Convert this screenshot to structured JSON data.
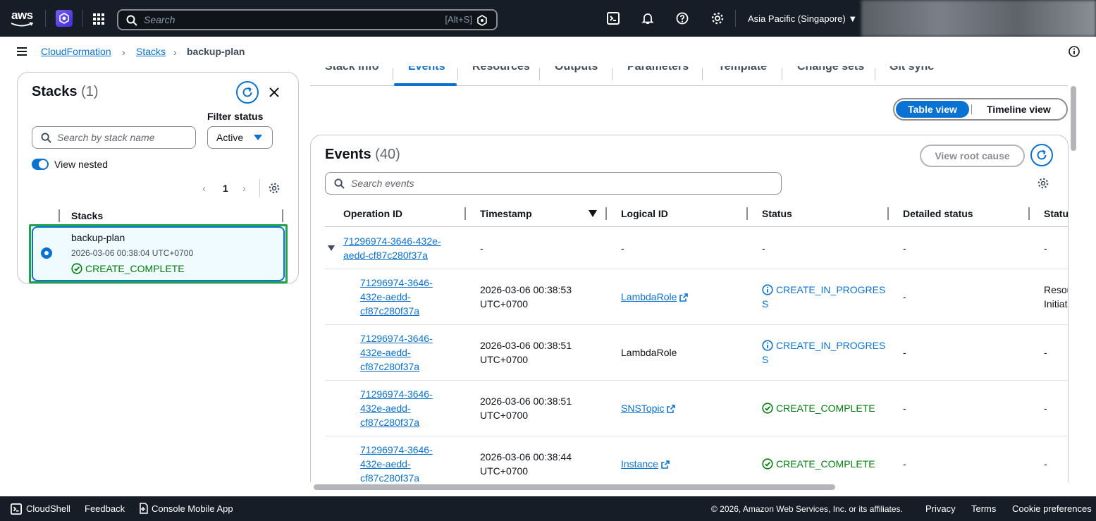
{
  "topnav": {
    "logo_text": "aws",
    "search_placeholder": "Search",
    "search_hint": "[Alt+S]",
    "region": "Asia Pacific (Singapore) ▼"
  },
  "breadcrumb": {
    "items": [
      "CloudFormation",
      "Stacks",
      "backup-plan"
    ]
  },
  "stacks_panel": {
    "title": "Stacks",
    "count": "(1)",
    "filter_label": "Filter status",
    "search_placeholder": "Search by stack name",
    "filter_value": "Active",
    "toggle_label": "View nested",
    "page": "1",
    "column_header": "Stacks",
    "stack": {
      "name": "backup-plan",
      "created": "2026-03-06 00:38:04 UTC+0700",
      "status": "CREATE_COMPLETE"
    }
  },
  "tabs": [
    "Stack info",
    "Events",
    "Resources",
    "Outputs",
    "Parameters",
    "Template",
    "Change sets",
    "Git sync"
  ],
  "view_toggle": {
    "table": "Table view",
    "timeline": "Timeline view"
  },
  "events": {
    "title": "Events",
    "count": "(40)",
    "root_cause_label": "View root cause",
    "search_placeholder": "Search events",
    "columns": [
      "Operation ID",
      "Timestamp",
      "Logical ID",
      "Status",
      "Detailed status",
      "Status reason"
    ],
    "group_row": {
      "operation_id_1": "71296974-3646-432e-",
      "operation_id_2": "aedd-cf87c280f37a",
      "timestamp": "-",
      "logical_id": "-",
      "status": "-",
      "detailed": "-",
      "reason": "-"
    },
    "rows": [
      {
        "op1": "71296974-3646-",
        "op2": "432e-aedd-",
        "op3": "cf87c280f37a",
        "ts1": "2026-03-06 00:38:53",
        "ts2": "UTC+0700",
        "logical": "LambdaRole",
        "status1": "CREATE_IN_PROGRES",
        "status2": "S",
        "detailed": "-",
        "reason1": "Resource creation",
        "reason2": "Initiated"
      },
      {
        "op1": "71296974-3646-",
        "op2": "432e-aedd-",
        "op3": "cf87c280f37a",
        "ts1": "2026-03-06 00:38:51",
        "ts2": "UTC+0700",
        "logical": "LambdaRole",
        "status1": "CREATE_IN_PROGRES",
        "status2": "S",
        "detailed": "-",
        "reason1": "-",
        "reason2": ""
      },
      {
        "op1": "71296974-3646-",
        "op2": "432e-aedd-",
        "op3": "cf87c280f37a",
        "ts1": "2026-03-06 00:38:51",
        "ts2": "UTC+0700",
        "logical": "SNSTopic",
        "status1": "CREATE_COMPLETE",
        "status2": "",
        "detailed": "-",
        "reason1": "-",
        "reason2": ""
      },
      {
        "op1": "71296974-3646-",
        "op2": "432e-aedd-",
        "op3": "cf87c280f37a",
        "ts1": "2026-03-06 00:38:44",
        "ts2": "UTC+0700",
        "logical": "Instance",
        "status1": "CREATE_COMPLETE",
        "status2": "",
        "detailed": "-",
        "reason1": "-",
        "reason2": ""
      }
    ]
  },
  "footer": {
    "cloudshell": "CloudShell",
    "feedback": "Feedback",
    "mobile": "Console Mobile App",
    "copyright": "© 2026, Amazon Web Services, Inc. or its affiliates.",
    "privacy": "Privacy",
    "terms": "Terms",
    "cookies": "Cookie preferences"
  }
}
